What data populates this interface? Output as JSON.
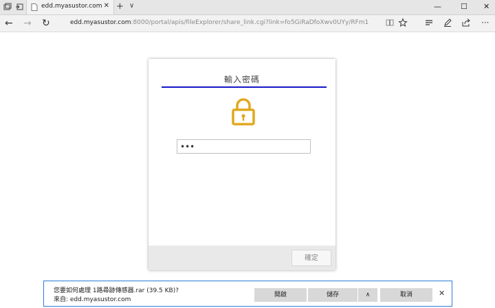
{
  "tab": {
    "title": "edd.myasustor.com",
    "close": "✕",
    "new_tab": "+",
    "tab_menu": "∨"
  },
  "window": {
    "minimize": "—",
    "maximize": "☐",
    "close": "✕"
  },
  "nav": {
    "back": "←",
    "forward": "→",
    "refresh": "↻",
    "url_host": "edd.myasustor.com",
    "url_path": ":8000/portal/apis/fileExplorer/share_link.cgi?link=fo5GiRaDfoXwv0UYy/RFm1"
  },
  "dialog": {
    "heading": "輸入密碼",
    "password_value": "•••",
    "confirm_label": "確定",
    "accent_color": "#1414c8",
    "lock_color": "#e0a81e"
  },
  "download": {
    "prompt": "您要如何處理 1路尋跡傳感器.rar (39.5 KB)?",
    "source": "來自: edd.myasustor.com",
    "open_label": "開啟",
    "save_label": "儲存",
    "more_label": "∧",
    "cancel_label": "取消",
    "close": "✕"
  },
  "icons": [
    "tab-manager-icon",
    "set-aside-tabs-icon",
    "favicon-page-icon",
    "reading-view-icon",
    "favorite-star-icon",
    "hub-icon",
    "notes-pen-icon",
    "share-icon",
    "lock-icon"
  ]
}
